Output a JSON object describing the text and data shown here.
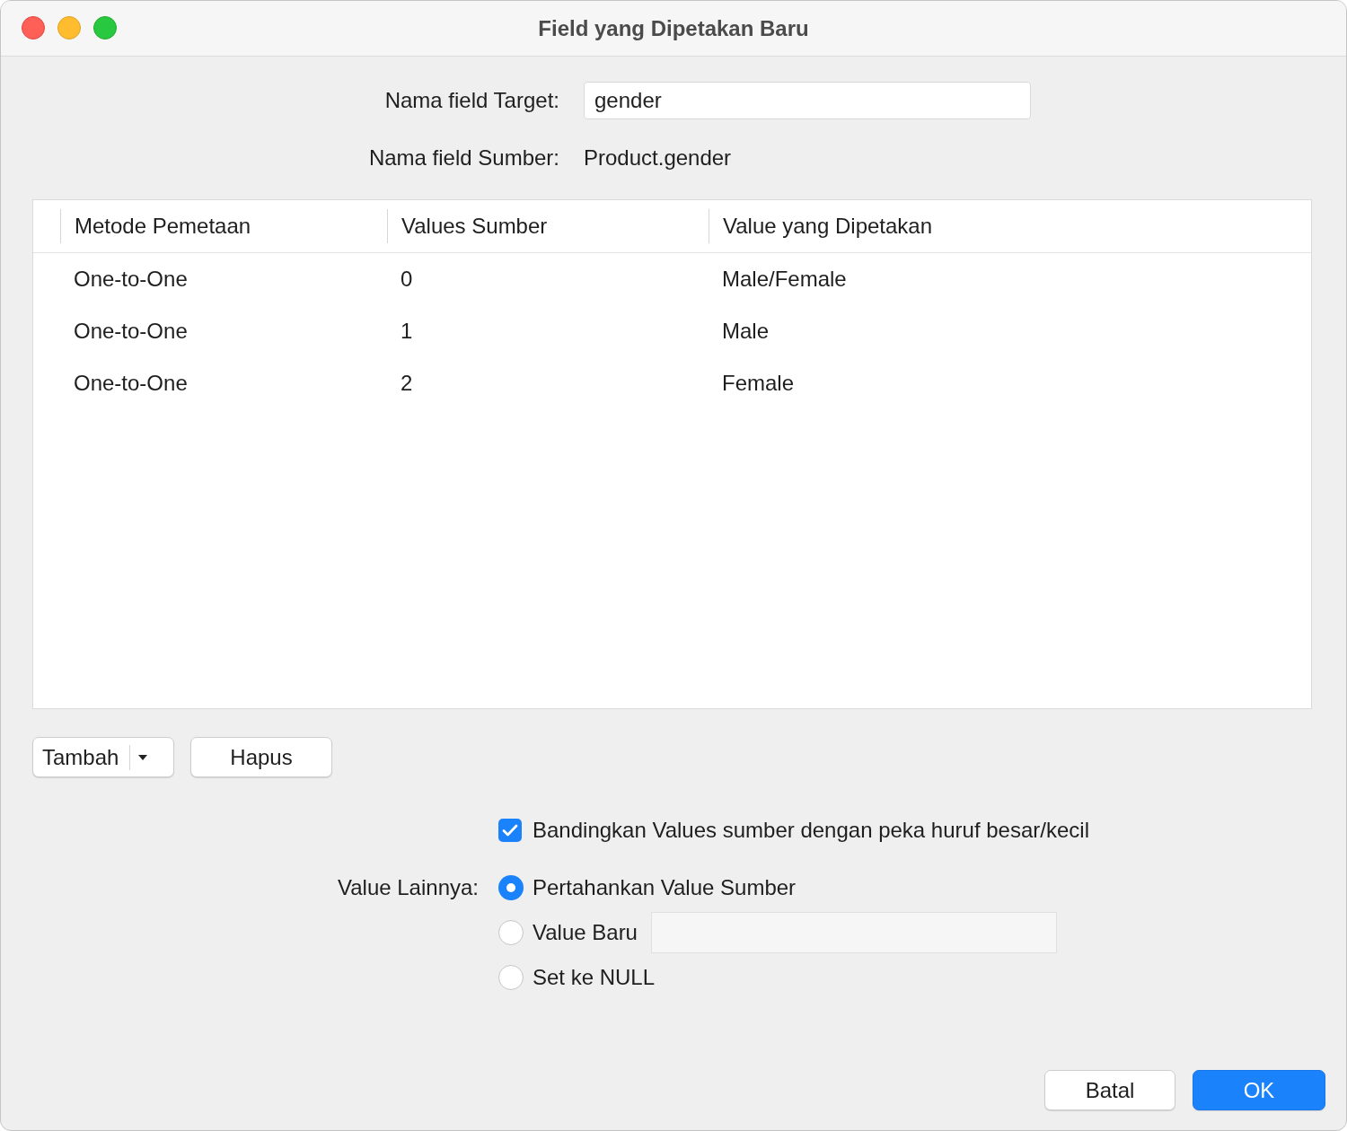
{
  "window": {
    "title": "Field yang Dipetakan Baru"
  },
  "target_field": {
    "label": "Nama field Target:",
    "value": "gender"
  },
  "source_field": {
    "label": "Nama field Sumber:",
    "value": "Product.gender"
  },
  "table": {
    "columns": [
      "Metode Pemetaan",
      "Values Sumber",
      "Value yang Dipetakan"
    ],
    "rows": [
      [
        "One-to-One",
        "0",
        "Male/Female"
      ],
      [
        "One-to-One",
        "1",
        "Male"
      ],
      [
        "One-to-One",
        "2",
        "Female"
      ]
    ]
  },
  "actions": [
    {
      "label": "Tambah",
      "kind": "split"
    },
    {
      "label": "Hapus",
      "kind": "plain"
    }
  ],
  "case_sensitive": {
    "label": "Bandingkan Values sumber dengan peka huruf besar/kecil",
    "checked": true
  },
  "other_values": {
    "label": "Value Lainnya:",
    "options": [
      {
        "label": "Pertahankan Value Sumber",
        "selected": true,
        "kind": "plain"
      },
      {
        "label": "Value Baru",
        "selected": false,
        "kind": "input",
        "field_disabled": true
      },
      {
        "label": "Set ke NULL",
        "selected": false,
        "kind": "plain"
      }
    ]
  },
  "buttons": [
    {
      "label": "Batal",
      "kind": "default"
    },
    {
      "label": "OK",
      "kind": "primary"
    }
  ]
}
